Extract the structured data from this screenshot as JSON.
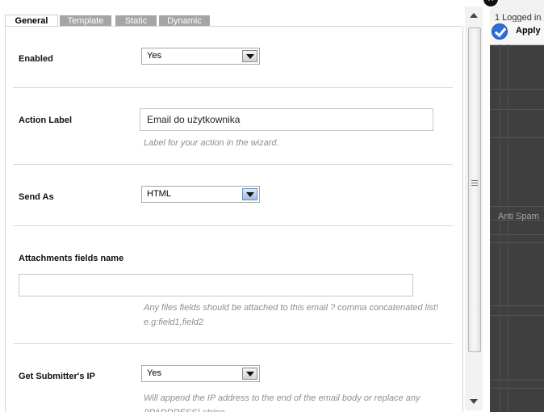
{
  "tabs": [
    {
      "label": "General",
      "active": true
    },
    {
      "label": "Template",
      "active": false
    },
    {
      "label": "Static",
      "active": false
    },
    {
      "label": "Dynamic",
      "active": false
    }
  ],
  "form": {
    "enabled": {
      "label": "Enabled",
      "value": "Yes"
    },
    "action_label": {
      "label": "Action Label",
      "value": "Email do użytkownika",
      "hint": "Label for your action in the wizard."
    },
    "send_as": {
      "label": "Send As",
      "value": "HTML"
    },
    "attachments": {
      "label": "Attachments fields name",
      "value": "",
      "hint_line1": "Any files fields should be attached to this email ? comma concatenated list!",
      "hint_line2": "e.g:field1,field2"
    },
    "submitter_ip": {
      "label": "Get Submitter's IP",
      "value": "Yes",
      "hint_line1": "Will append the IP address to the end of the email body or replace any",
      "hint_line2": "{IPADDRESS} string"
    }
  },
  "background_app": {
    "logged_in": "1 Logged in",
    "apply_label": "Apply",
    "anti_spam": "Anti Spam"
  },
  "icons": {
    "close": "close-icon",
    "apply": "checkmark-icon"
  },
  "colors": {
    "tab_inactive": "#a5a5a5",
    "apply_blue": "#2f6fd8",
    "hint_text": "#8e8e8e"
  }
}
